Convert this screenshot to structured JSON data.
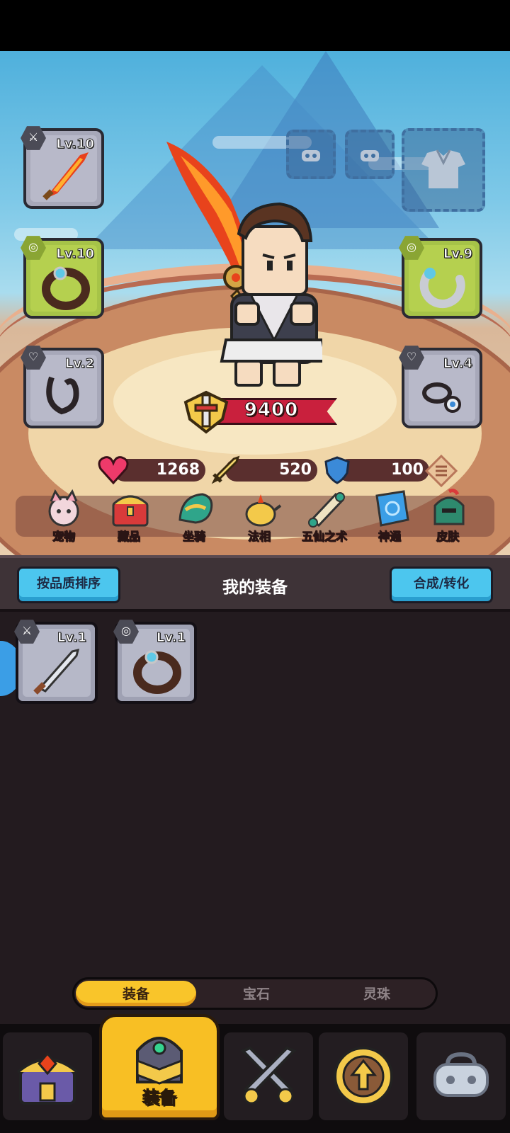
{
  "equipment_slots": {
    "weapon": {
      "icon": "flame-sword-icon",
      "level": "Lv.10",
      "type_icon": "sword"
    },
    "ring_left": {
      "icon": "ring-icon",
      "level": "Lv.10",
      "type_icon": "ring"
    },
    "bracelet_right": {
      "icon": "bracelet-icon",
      "level": "Lv.9",
      "type_icon": "ring"
    },
    "necklace_left": {
      "icon": "necklace-icon",
      "level": "Lv.2",
      "type_icon": "necklace"
    },
    "amulet_right": {
      "icon": "amulet-icon",
      "level": "Lv.4",
      "type_icon": "necklace"
    }
  },
  "power": "9400",
  "stats": {
    "hp": "1268",
    "attack": "520",
    "defense": "100"
  },
  "features": [
    "宠物",
    "藏品",
    "坐骑",
    "法相",
    "五仙之术",
    "神通",
    "皮肤"
  ],
  "inventory": {
    "sort_button": "按品质排序",
    "title": "我的装备",
    "convert_button": "合成/转化",
    "items": [
      {
        "icon": "knife-icon",
        "level": "Lv.1"
      },
      {
        "icon": "ring-icon",
        "level": "Lv.1"
      }
    ]
  },
  "tabs": {
    "items": [
      "装备",
      "宝石",
      "灵珠"
    ],
    "active": "装备"
  },
  "bottom_nav": {
    "active_label": "装备"
  },
  "colors": {
    "accent_yellow": "#f9c52a",
    "button_blue": "#4cc6ee",
    "panel_bg": "#231b1f",
    "power_red": "#c9203d"
  }
}
